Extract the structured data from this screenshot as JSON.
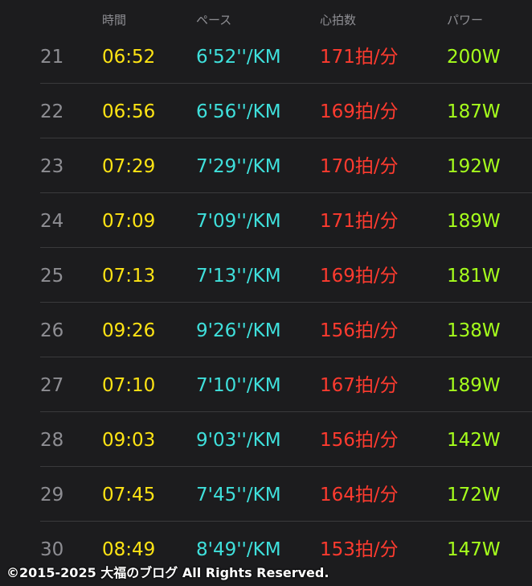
{
  "header": {
    "time_label": "時間",
    "pace_label": "ペース",
    "heart_rate_label": "心拍数",
    "power_label": "パワー"
  },
  "splits": [
    {
      "index": "21",
      "time": "06:52",
      "pace": "6'52''/KM",
      "heart_rate": "171拍/分",
      "power": "200W"
    },
    {
      "index": "22",
      "time": "06:56",
      "pace": "6'56''/KM",
      "heart_rate": "169拍/分",
      "power": "187W"
    },
    {
      "index": "23",
      "time": "07:29",
      "pace": "7'29''/KM",
      "heart_rate": "170拍/分",
      "power": "192W"
    },
    {
      "index": "24",
      "time": "07:09",
      "pace": "7'09''/KM",
      "heart_rate": "171拍/分",
      "power": "189W"
    },
    {
      "index": "25",
      "time": "07:13",
      "pace": "7'13''/KM",
      "heart_rate": "169拍/分",
      "power": "181W"
    },
    {
      "index": "26",
      "time": "09:26",
      "pace": "9'26''/KM",
      "heart_rate": "156拍/分",
      "power": "138W"
    },
    {
      "index": "27",
      "time": "07:10",
      "pace": "7'10''/KM",
      "heart_rate": "167拍/分",
      "power": "189W"
    },
    {
      "index": "28",
      "time": "09:03",
      "pace": "9'03''/KM",
      "heart_rate": "156拍/分",
      "power": "142W"
    },
    {
      "index": "29",
      "time": "07:45",
      "pace": "7'45''/KM",
      "heart_rate": "164拍/分",
      "power": "172W"
    },
    {
      "index": "30",
      "time": "08:49",
      "pace": "8'49''/KM",
      "heart_rate": "153拍/分",
      "power": "147W"
    }
  ],
  "footer": {
    "copyright": "©2015-2025 大福のブログ All Rights Reserved."
  },
  "colors": {
    "background": "#1c1c1e",
    "index": "#8e8e93",
    "time": "#ffe414",
    "pace": "#3fe0dc",
    "heart_rate": "#ff3b2f",
    "power": "#a6ff1c",
    "divider": "#3a3a3c"
  }
}
